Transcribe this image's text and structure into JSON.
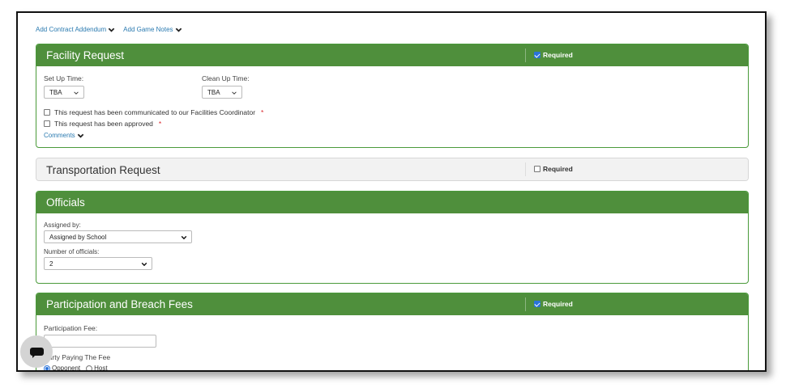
{
  "top_links": {
    "addendum": "Add Contract Addendum",
    "notes": "Add Game Notes"
  },
  "facility": {
    "title": "Facility Request",
    "required_label": "Required",
    "required_checked": true,
    "setup_label": "Set Up Time:",
    "setup_value": "TBA",
    "cleanup_label": "Clean Up Time:",
    "cleanup_value": "TBA",
    "check1_label": "This request has been communicated to our Facilities Coordinator",
    "check2_label": "This request has been approved",
    "required_star": "*",
    "comments_label": "Comments"
  },
  "transportation": {
    "title": "Transportation Request",
    "required_label": "Required",
    "required_checked": false
  },
  "officials": {
    "title": "Officials",
    "assigned_label": "Assigned by:",
    "assigned_value": "Assigned by School",
    "number_label": "Number of officials:",
    "number_value": "2"
  },
  "fees": {
    "title": "Participation and Breach Fees",
    "required_label": "Required",
    "required_checked": true,
    "fee_label": "Participation Fee:",
    "fee_value": "",
    "party_label": "Party Paying The Fee",
    "options": [
      "Opponent",
      "Host"
    ],
    "selected": "Opponent"
  },
  "icons": {
    "chevron": "chevron-down-icon",
    "chat": "chat-icon"
  },
  "colors": {
    "header_green": "#4f8f3c",
    "link_blue": "#2a7ab0",
    "required_star": "#d9262c"
  }
}
